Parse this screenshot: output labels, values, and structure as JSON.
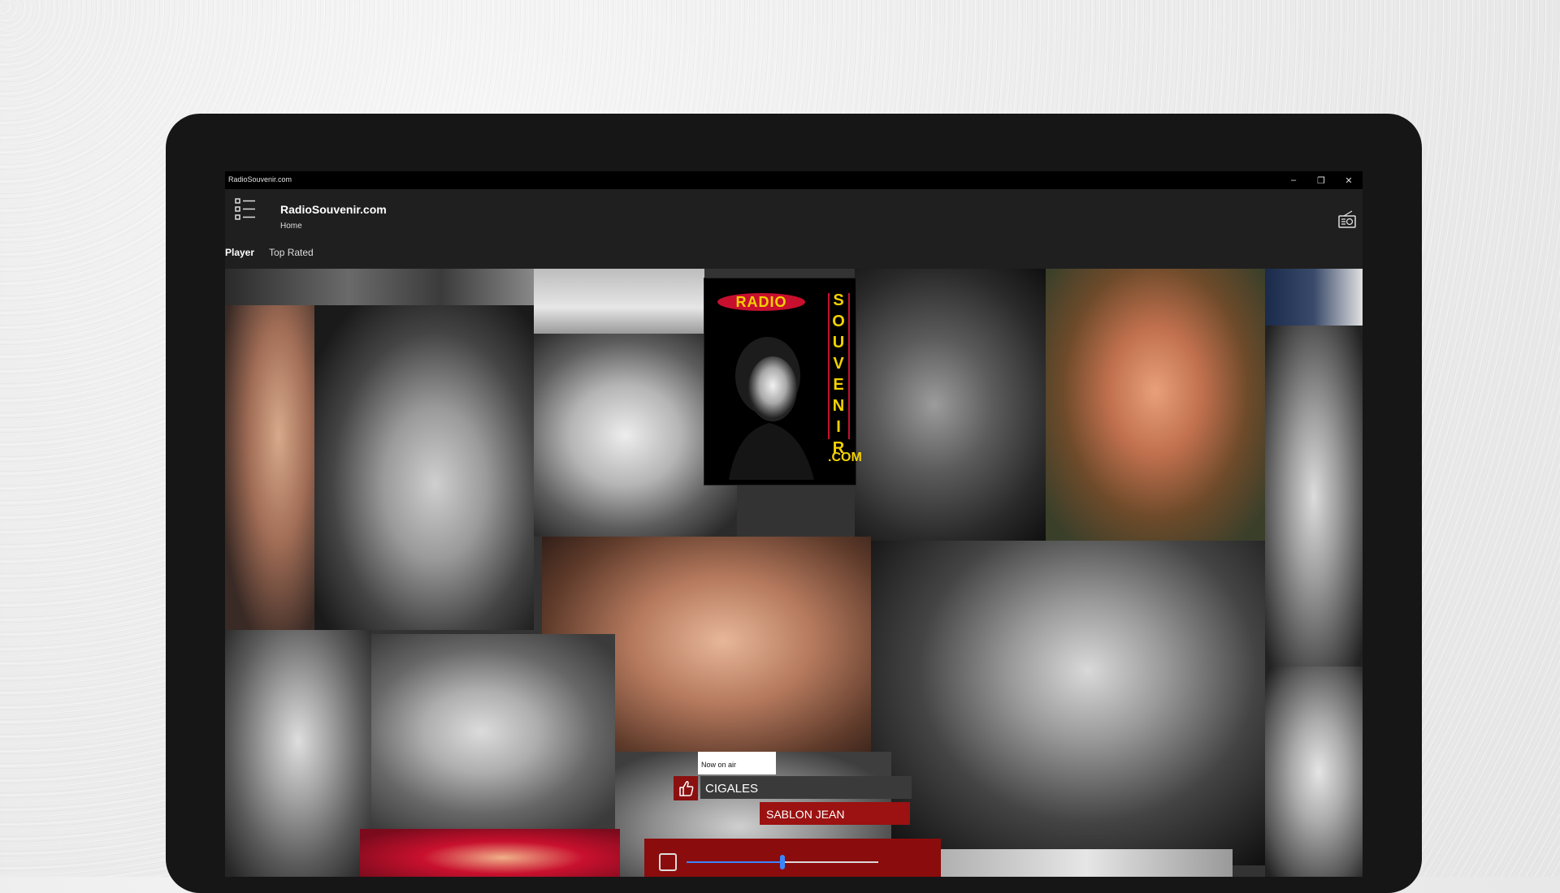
{
  "window": {
    "title": "RadioSouvenir.com",
    "controls": {
      "minimize": "–",
      "restore": "❐",
      "close": "✕"
    }
  },
  "header": {
    "app_title": "RadioSouvenir.com",
    "subtitle": "Home",
    "menu_icon": "list-menu-icon",
    "radio_icon": "radio-icon"
  },
  "tabs": [
    {
      "label": "Player",
      "active": true
    },
    {
      "label": "Top Rated",
      "active": false
    }
  ],
  "logo": {
    "radio": "RADIO",
    "souvenir_letters": [
      "S",
      "O",
      "U",
      "V",
      "E",
      "N",
      "I",
      "R"
    ],
    "com": ".COM"
  },
  "now_playing": {
    "label": "Now on air",
    "song": "CIGALES",
    "artist": "SABLON JEAN",
    "like_icon": "thumbs-up-icon"
  },
  "player": {
    "stop_icon": "stop-icon",
    "volume_fraction": 0.5
  },
  "colors": {
    "accent_red": "#9c1111",
    "slider_blue": "#3b86ff",
    "logo_yellow": "#f3d100"
  }
}
